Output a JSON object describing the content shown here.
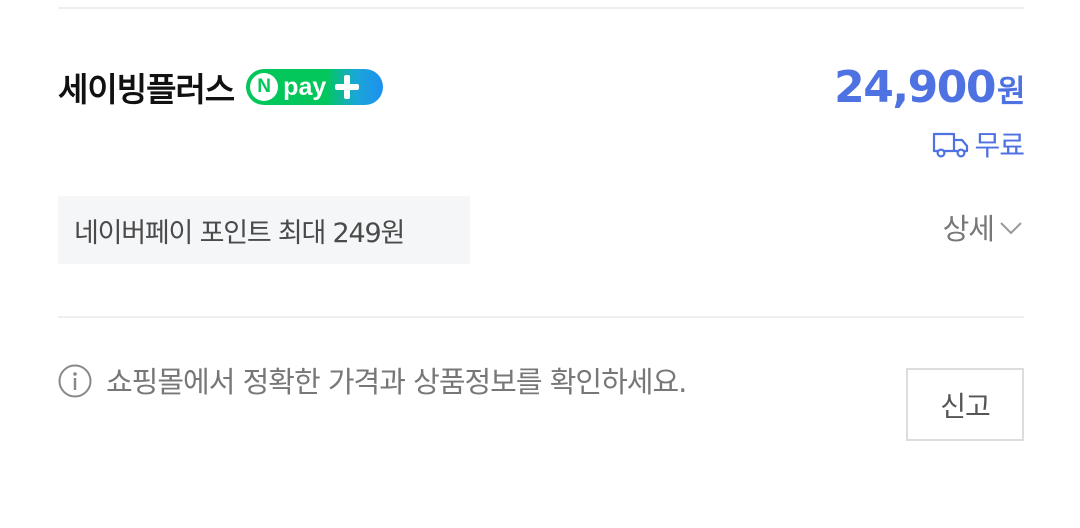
{
  "seller": {
    "name": "세이빙플러스",
    "badge": {
      "n_letter": "N",
      "text": "pay"
    }
  },
  "price": {
    "amount": "24,900",
    "unit": "원",
    "color": "#4f72e3"
  },
  "shipping": {
    "label": "무료",
    "icon": "truck-icon"
  },
  "points": {
    "text": "네이버페이 포인트 최대 249원"
  },
  "detail": {
    "label": "상세",
    "icon": "chevron-down-icon"
  },
  "notice": {
    "icon": "info-icon",
    "text": "쇼핑몰에서 정확한 가격과 상품정보를 확인하세요."
  },
  "report": {
    "label": "신고"
  },
  "colors": {
    "npay_green": "#03c75a",
    "npay_blue": "#1e90ef",
    "accent_blue": "#4f72e3"
  }
}
